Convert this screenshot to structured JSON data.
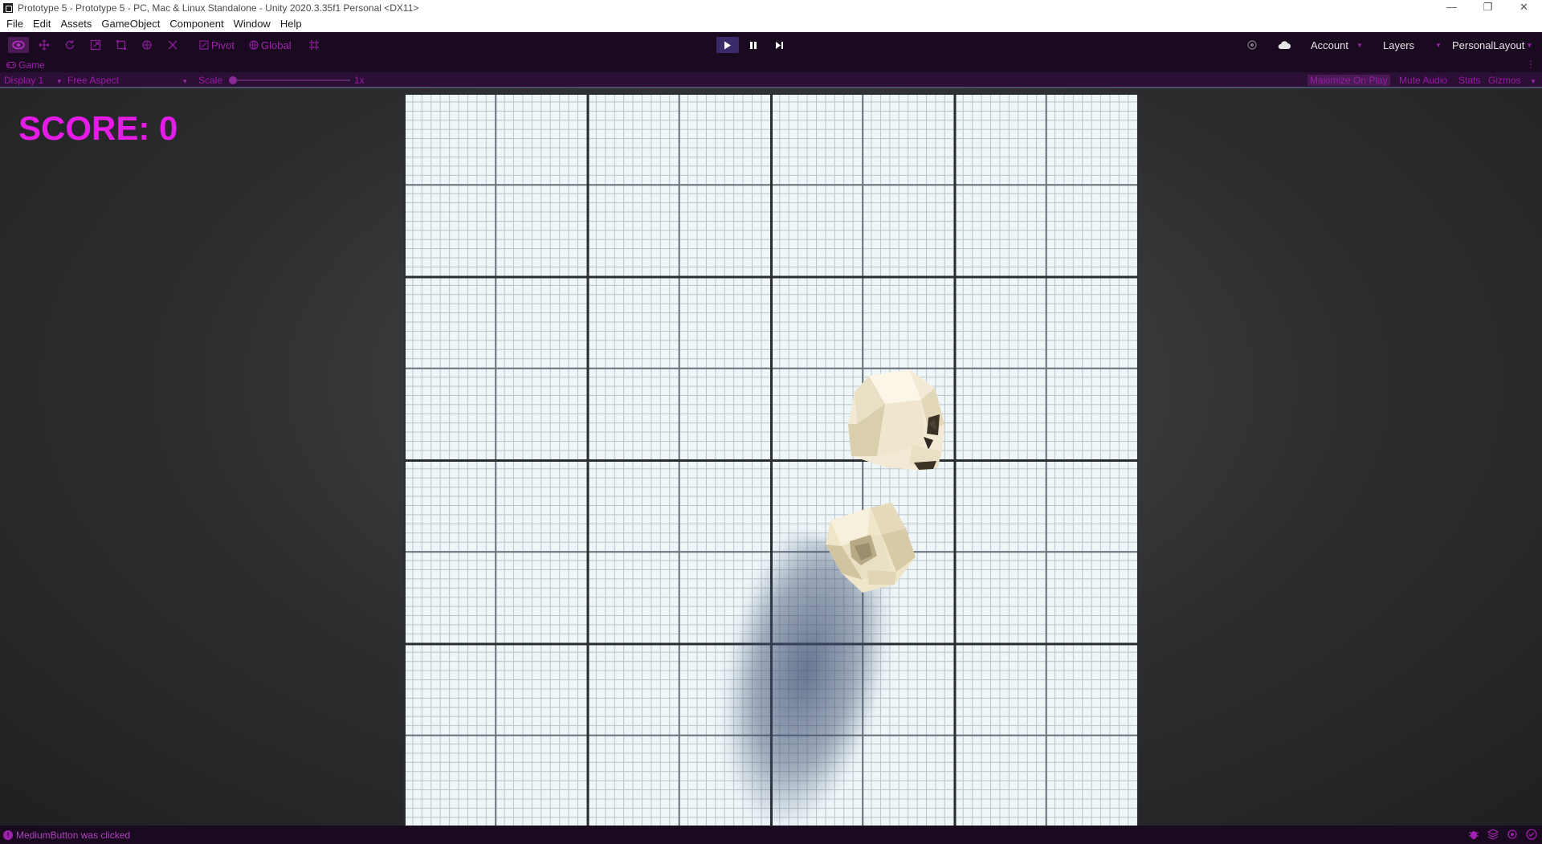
{
  "window": {
    "title": "Prototype 5 - Prototype 5 - PC, Mac & Linux Standalone - Unity 2020.3.35f1 Personal <DX11>",
    "minimize": "—",
    "restore": "❐",
    "close": "✕"
  },
  "menu": [
    "File",
    "Edit",
    "Assets",
    "GameObject",
    "Component",
    "Window",
    "Help"
  ],
  "toolbar": {
    "pivot_label": "Pivot",
    "global_label": "Global",
    "account_label": "Account",
    "layers_label": "Layers",
    "layout_label": "PersonalLayout"
  },
  "game_tab": {
    "label": "Game",
    "more": "⋮"
  },
  "game_bar": {
    "display": "Display 1",
    "aspect": "Free Aspect",
    "scale_label": "Scale",
    "scale_value": "1x",
    "maximize_on_play": "Maximize On Play",
    "mute_audio": "Mute Audio",
    "stats": "Stats",
    "gizmos": "Gizmos"
  },
  "hud": {
    "score": "SCORE: 0"
  },
  "status": {
    "message": "MediumButton was clicked"
  },
  "colors": {
    "accent": "#a020b0",
    "score": "#e51be8",
    "toolbar_bg": "#1a0a1f"
  }
}
